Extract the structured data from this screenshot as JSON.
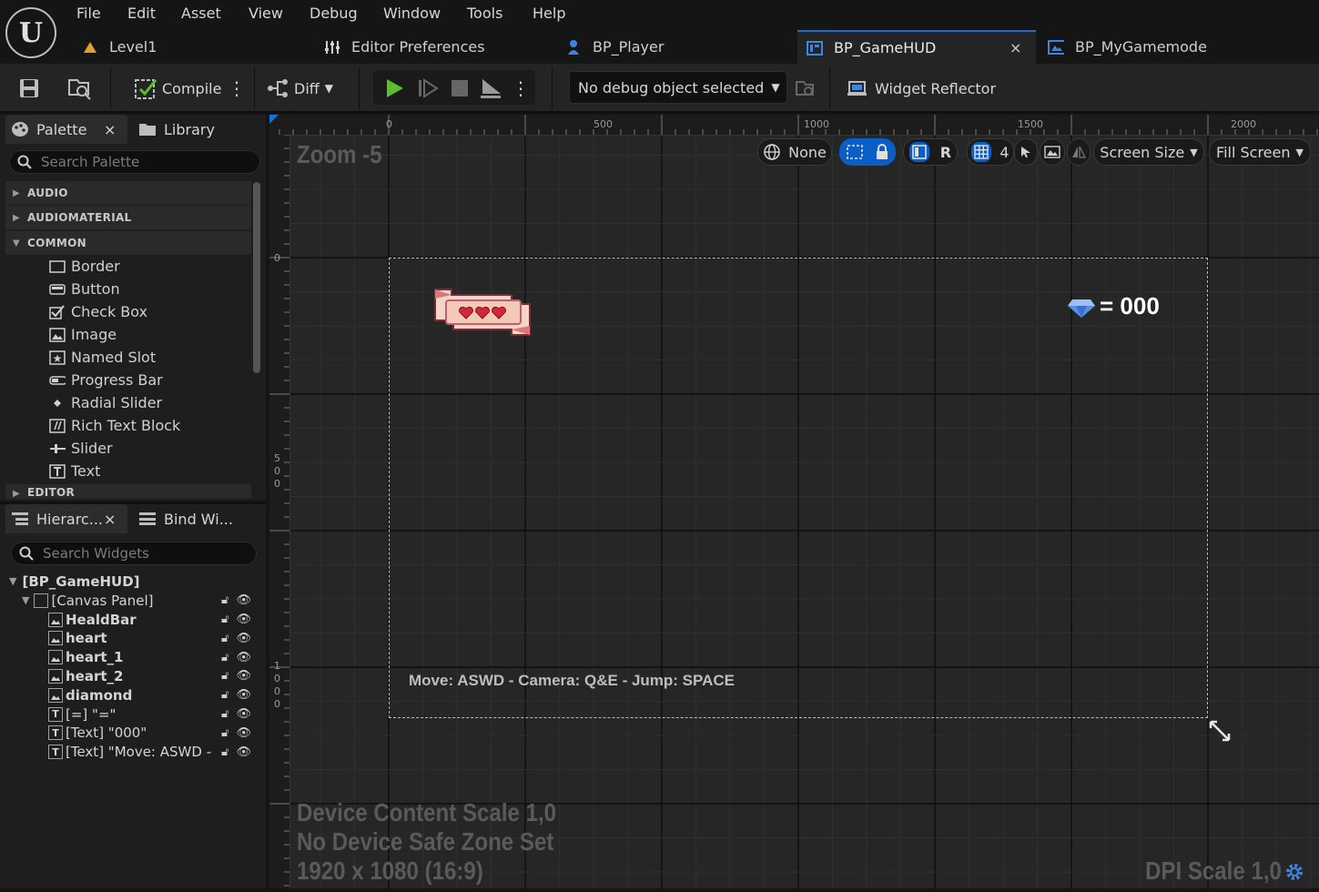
{
  "menu": [
    "File",
    "Edit",
    "Asset",
    "View",
    "Debug",
    "Window",
    "Tools",
    "Help"
  ],
  "tabs": [
    {
      "label": "Level1",
      "icon": "level-icon"
    },
    {
      "label": "Editor Preferences",
      "icon": "preferences-sliders-icon"
    },
    {
      "label": "BP_Player",
      "icon": "pawn-icon"
    },
    {
      "label": "BP_GameHUD",
      "icon": "widget-blueprint-icon",
      "active": true
    },
    {
      "label": "BP_MyGamemode",
      "icon": "gamemode-icon"
    }
  ],
  "tab_close": "×",
  "toolbar": {
    "compile_label": "Compile",
    "diff_label": "Diff",
    "debug_select": "No debug object selected",
    "widget_reflector": "Widget Reflector"
  },
  "palette": {
    "tab_label": "Palette",
    "library_label": "Library",
    "close": "×",
    "search_placeholder": "Search Palette",
    "categories": [
      "AUDIO",
      "AUDIOMATERIAL",
      "COMMON",
      "EDITOR"
    ],
    "common_items": [
      "Border",
      "Button",
      "Check Box",
      "Image",
      "Named Slot",
      "Progress Bar",
      "Radial Slider",
      "Rich Text Block",
      "Slider",
      "Text"
    ]
  },
  "hierarchy": {
    "tab_label": "Hierarc...",
    "bind_label": "Bind Wi...",
    "close": "×",
    "search_placeholder": "Search Widgets",
    "root": "[BP_GameHUD]",
    "canvas": "[Canvas Panel]",
    "children": [
      {
        "label": "HealdBar",
        "type": "image"
      },
      {
        "label": "heart",
        "type": "image"
      },
      {
        "label": "heart_1",
        "type": "image"
      },
      {
        "label": "heart_2",
        "type": "image"
      },
      {
        "label": "diamond",
        "type": "image"
      },
      {
        "label": "[=] \"=\"",
        "type": "text"
      },
      {
        "label": "[Text] \"000\"",
        "type": "text"
      },
      {
        "label": "[Text] \"Move: ASWD -",
        "type": "text"
      }
    ]
  },
  "viewport": {
    "zoom": "Zoom -5",
    "ruler_top": [
      "0",
      "500",
      "1000",
      "1500",
      "2000"
    ],
    "ruler_left_0": "0",
    "ruler_left_500": [
      "5",
      "0",
      "0"
    ],
    "ruler_left_1000": [
      "1",
      "0",
      "0",
      "0"
    ],
    "localization": "None",
    "r_label": "R",
    "grid_value": "4",
    "screen_size": "Screen Size",
    "fill_screen": "Fill Screen",
    "diamond_text": "= 000",
    "hint_text": "Move: ASWD - Camera: Q&E - Jump: SPACE",
    "device_content_scale": "Device Content Scale 1,0",
    "safe_zone": "No Device Safe Zone Set",
    "resolution": "1920 x 1080 (16:9)",
    "dpi_scale": "DPI Scale 1,0"
  },
  "colors": {
    "accent": "#1a6fd1",
    "play": "#5bbf2b",
    "blue_btn": "#0a5ec7"
  }
}
